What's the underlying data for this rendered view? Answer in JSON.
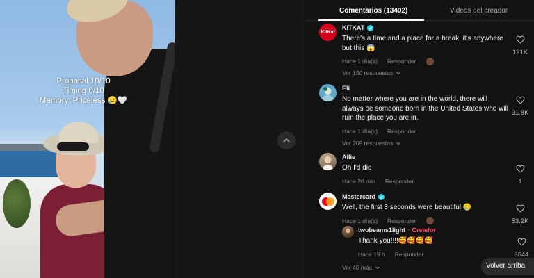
{
  "video": {
    "overlay_lines": [
      "Proposal 10/10",
      "Timing 0/10",
      "Memory: Priceless 🥲🤍"
    ]
  },
  "tabs": [
    {
      "label": "Comentarios (13402)",
      "active": true
    },
    {
      "label": "Videos del creador",
      "active": false
    }
  ],
  "comments": [
    {
      "user": "KITKAT",
      "verified": true,
      "avatar_text": "KitKat",
      "text": "There's a time and a place for a break, it's anywhere but this 😱",
      "time": "Hace 1 día(s)",
      "reply_label": "Responder",
      "liked_by_creator": true,
      "likes": "121K",
      "view_replies": "Ver 150 respuestas"
    },
    {
      "user": "Eli",
      "verified": false,
      "text": "No matter where you are in the world, there will always be someone born in the United States who will ruin the place you are in.",
      "time": "Hace 1 día(s)",
      "reply_label": "Responder",
      "liked_by_creator": false,
      "likes": "31.8K",
      "view_replies": "Ver 209 respuestas"
    },
    {
      "user": "Allie",
      "verified": false,
      "text": "Oh I'd die",
      "time": "Hace 20 min",
      "reply_label": "Responder",
      "liked_by_creator": false,
      "likes": "1",
      "view_replies": ""
    },
    {
      "user": "Mastercard",
      "verified": true,
      "text": "Well, the first 3 seconds were beautiful 🥲",
      "time": "Hace 1 día(s)",
      "reply_label": "Responder",
      "liked_by_creator": true,
      "likes": "53.2K",
      "view_replies": "Ver 40 más"
    }
  ],
  "reply": {
    "user": "twobeams1light",
    "creator_tag": "· Creador",
    "text": "Thank you!!!!🥰🥰🥰🥰",
    "time": "Hace 19 h",
    "reply_label": "Responder",
    "likes": "3644"
  },
  "back_to_top": "Volver arriba",
  "colors": {
    "background": "#121212",
    "verified": "#20d5ec",
    "creator": "#ff4466",
    "kitkat": "#d6001c"
  }
}
